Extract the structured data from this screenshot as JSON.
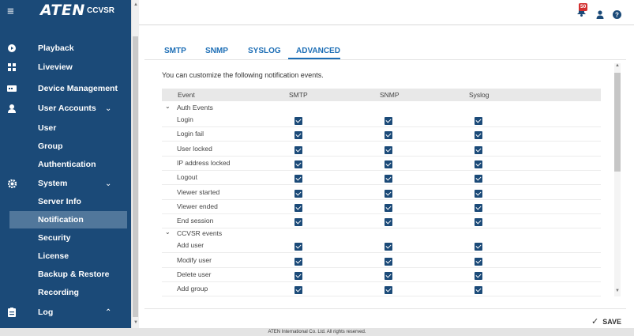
{
  "brand": {
    "logo": "ATEN",
    "product": "CCVSR"
  },
  "sidebar": {
    "items": [
      {
        "label": "Playback",
        "icon": "play-circle-icon"
      },
      {
        "label": "Liveview",
        "icon": "grid-icon"
      },
      {
        "label": "Device Management",
        "icon": "device-icon"
      },
      {
        "label": "User Accounts",
        "icon": "user-icon",
        "chevron": "⌄"
      },
      {
        "label": "User"
      },
      {
        "label": "Group"
      },
      {
        "label": "Authentication"
      },
      {
        "label": "System",
        "icon": "gear-icon",
        "chevron": "⌄"
      },
      {
        "label": "Server Info"
      },
      {
        "label": "Notification",
        "active": true
      },
      {
        "label": "Security"
      },
      {
        "label": "License"
      },
      {
        "label": "Backup & Restore"
      },
      {
        "label": "Recording"
      },
      {
        "label": "Log",
        "icon": "clipboard-icon",
        "chevron": "⌃"
      }
    ]
  },
  "header": {
    "notification_count": "50"
  },
  "tabs": [
    "SMTP",
    "SNMP",
    "SYSLOG",
    "ADVANCED"
  ],
  "active_tab": "ADVANCED",
  "content": {
    "intro": "You can customize the following notification events.",
    "columns": [
      "Event",
      "SMTP",
      "SNMP",
      "Syslog"
    ],
    "groups": [
      {
        "name": "Auth Events",
        "events": [
          "Login",
          "Login fail",
          "User locked",
          "IP address locked",
          "Logout",
          "Viewer started",
          "Viewer ended",
          "End session"
        ]
      },
      {
        "name": "CCVSR events",
        "events": [
          "Add user",
          "Modify user",
          "Delete user",
          "Add group"
        ]
      }
    ]
  },
  "save_label": "SAVE",
  "footer": "ATEN International Co. Ltd. All rights reserved.",
  "colors": {
    "sidebar": "#1b4a78",
    "active_nav": "#51779b",
    "accent": "#1b6db5",
    "badge": "#d32f2f"
  }
}
